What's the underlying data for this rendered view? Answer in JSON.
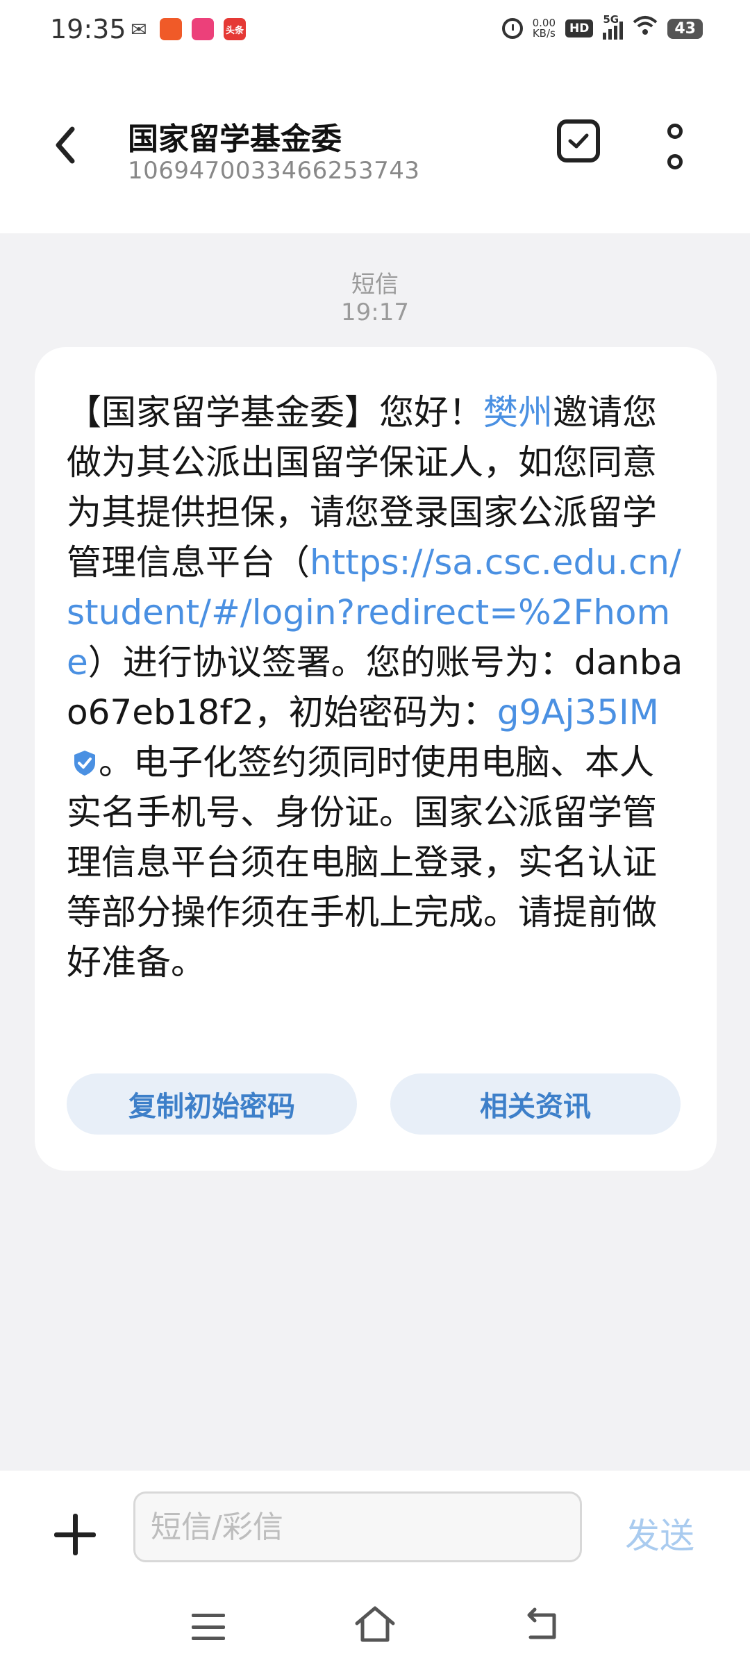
{
  "status_bar": {
    "time": "19:35",
    "net_speed_value": "0.00",
    "net_speed_unit": "KB/s",
    "hd": "HD",
    "network": "5G",
    "battery": "43",
    "app_icons": [
      "wechat-icon",
      "app-icon",
      "app-icon",
      "toutiao-icon"
    ],
    "app_labels": [
      "",
      "",
      "",
      "头条"
    ]
  },
  "header": {
    "contact_name": "国家留学基金委",
    "contact_number": "1069470033466253743"
  },
  "conversation": {
    "message_kind": "短信",
    "message_time": "19:17",
    "message": {
      "part1": "【国家留学基金委】您好！",
      "name_link": "樊州",
      "part2": "邀请您做为其公派出国留学保证人，如您同意为其提供担保，请您登录国家公派留学管理信息平台（",
      "url": "https://sa.csc.edu.cn/student/#/login?redirect=%2Fhome",
      "part3": "）进行协议签署。您的账号为：danbao67eb18f2，初始密码为：",
      "password": "g9Aj35IM",
      "part4": "。电子化签约须同时使用电脑、本人实名手机号、身份证。国家公派留学管理信息平台须在电脑上登录，实名认证等部分操作须在手机上完成。请提前做好准备。"
    },
    "actions": {
      "copy_password": "复制初始密码",
      "related_info": "相关资讯"
    }
  },
  "composer": {
    "placeholder": "短信/彩信",
    "value": "",
    "send_label": "发送"
  },
  "colors": {
    "link": "#4a90e2",
    "action_bg": "#e8eff8",
    "send_disabled": "#a9cbef",
    "background": "#f2f2f4"
  }
}
